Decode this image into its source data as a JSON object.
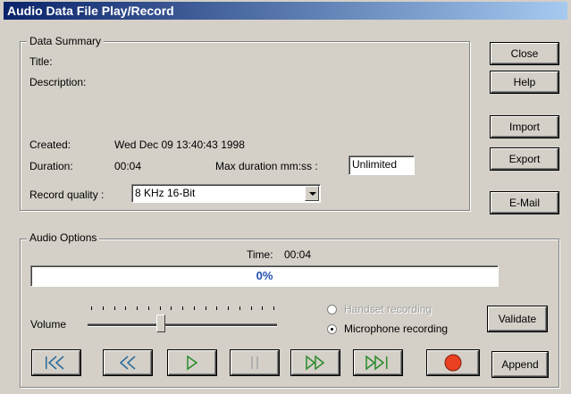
{
  "window": {
    "title": "Audio Data File Play/Record"
  },
  "summary": {
    "group_label": "Data Summary",
    "title_label": "Title:",
    "description_label": "Description:",
    "created_label": "Created:",
    "created_value": "Wed Dec 09 13:40:43 1998",
    "duration_label": "Duration:",
    "duration_value": "00:04",
    "max_duration_label": "Max duration mm:ss :",
    "max_duration_value": "Unlimited",
    "quality_label": "Record quality :",
    "quality_value": "8 KHz 16-Bit"
  },
  "side_buttons": {
    "close": "Close",
    "help": "Help",
    "import": "Import",
    "export": "Export",
    "email": "E-Mail"
  },
  "audio": {
    "group_label": "Audio Options",
    "time_label": "Time:",
    "time_value": "00:04",
    "progress_text": "0%",
    "progress_fraction": 0,
    "volume_label": "Volume",
    "volume_fraction": 0.38,
    "handset_label": "Handset recording",
    "microphone_label": "Microphone recording",
    "selected_source": "microphone",
    "validate_label": "Validate",
    "append_label": "Append"
  },
  "transport": [
    {
      "name": "rewind-to-start-icon"
    },
    {
      "name": "rewind-icon"
    },
    {
      "name": "play-icon"
    },
    {
      "name": "pause-icon"
    },
    {
      "name": "fast-forward-icon"
    },
    {
      "name": "forward-to-end-icon"
    },
    {
      "name": "record-icon"
    }
  ],
  "colors": {
    "title_bar_start": "#0a246a",
    "title_bar_end": "#a6caf0",
    "accent_icons": "#2a8a2a",
    "record": "#e84020",
    "progress_text": "#2050b0"
  }
}
